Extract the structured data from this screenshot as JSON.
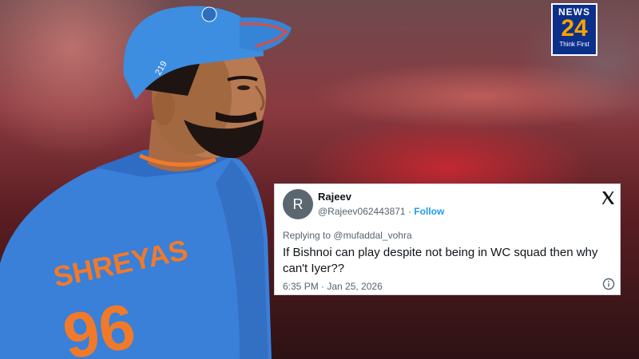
{
  "logo": {
    "line1": "NEWS",
    "line2": "24",
    "tagline": "Think First"
  },
  "player": {
    "jersey_name": "SHREYAS",
    "jersey_number": "96",
    "cap_number": "219"
  },
  "tweet": {
    "avatar_initial": "R",
    "display_name": "Rajeev",
    "handle": "@Rajeev062443871",
    "separator": "·",
    "follow_label": "Follow",
    "replying_to_label": "Replying to",
    "replying_to_handle": "@mufaddal_vohra",
    "text": "If Bishnoi can play despite not being in WC squad then why can't Iyer??",
    "timestamp": "6:35 PM · Jan 25, 2026",
    "icons": {
      "platform": "x-logo-icon",
      "info": "info-icon"
    }
  },
  "colors": {
    "follow": "#1d9bf0",
    "logo_bg": "#0c2f8a",
    "logo_accent": "#f5a300",
    "jersey": "#3a7fd8"
  }
}
